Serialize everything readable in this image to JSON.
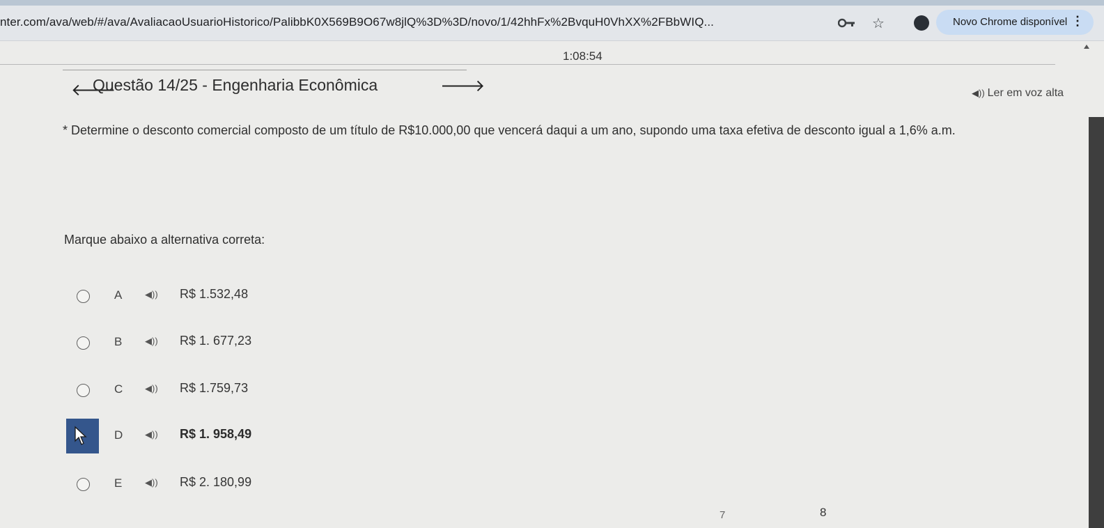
{
  "browser": {
    "url": "nter.com/ava/web/#/ava/AvaliacaoUsuarioHistorico/PalibbK0X569B9O67w8jlQ%3D%3D/novo/1/42hhFx%2BvquH0VhXX%2FBbWIQ...",
    "update_label": "Novo Chrome disponível",
    "icons": [
      "key-icon",
      "star-icon",
      "profile-icon",
      "kebab-icon"
    ]
  },
  "exam": {
    "timer": "1:08:54",
    "title": "Questão 14/25 - Engenharia Econômica",
    "tts_label": "Ler em voz alta",
    "question": "* Determine o desconto comercial composto de um título de R$10.000,00 que vencerá daqui a um ano, supondo uma taxa efetiva de desconto igual a 1,6% a.m.",
    "instruction": "Marque abaixo a alternativa correta:",
    "options": [
      {
        "letter": "A",
        "value": "R$ 1.532,48"
      },
      {
        "letter": "B",
        "value": "R$ 1. 677,23"
      },
      {
        "letter": "C",
        "value": "R$ 1.759,73"
      },
      {
        "letter": "D",
        "value": "R$ 1. 958,49"
      },
      {
        "letter": "E",
        "value": "R$ 2. 180,99"
      }
    ],
    "selected": "D"
  },
  "footer": {
    "page_numbers": [
      "7",
      "8"
    ]
  }
}
